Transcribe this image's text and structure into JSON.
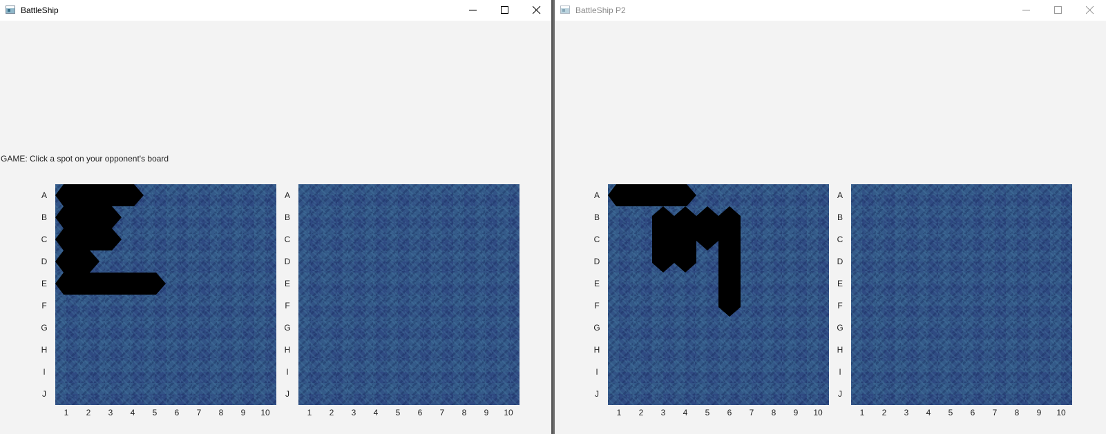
{
  "windows": [
    {
      "id": "win1",
      "title": "BattleShip",
      "active": true,
      "status": "GAME: Click a spot on your opponent's board",
      "boards": [
        {
          "label": "own-board",
          "ships": [
            {
              "row": "A",
              "col": 1,
              "length": 4,
              "orientation": "horizontal"
            },
            {
              "row": "B",
              "col": 1,
              "length": 3,
              "orientation": "horizontal"
            },
            {
              "row": "C",
              "col": 1,
              "length": 3,
              "orientation": "horizontal"
            },
            {
              "row": "D",
              "col": 1,
              "length": 2,
              "orientation": "horizontal"
            },
            {
              "row": "E",
              "col": 1,
              "length": 5,
              "orientation": "horizontal"
            }
          ]
        },
        {
          "label": "target-board",
          "ships": []
        }
      ]
    },
    {
      "id": "win2",
      "title": "BattleShip P2",
      "active": false,
      "status": "",
      "boards": [
        {
          "label": "own-board",
          "ships": [
            {
              "row": "A",
              "col": 1,
              "length": 4,
              "orientation": "horizontal"
            },
            {
              "row": "B",
              "col": 3,
              "length": 3,
              "orientation": "vertical"
            },
            {
              "row": "B",
              "col": 4,
              "length": 3,
              "orientation": "vertical"
            },
            {
              "row": "B",
              "col": 5,
              "length": 2,
              "orientation": "vertical"
            },
            {
              "row": "B",
              "col": 6,
              "length": 5,
              "orientation": "vertical"
            }
          ]
        },
        {
          "label": "target-board",
          "ships": []
        }
      ]
    }
  ],
  "rows": [
    "A",
    "B",
    "C",
    "D",
    "E",
    "F",
    "G",
    "H",
    "I",
    "J"
  ],
  "cols": [
    "1",
    "2",
    "3",
    "4",
    "5",
    "6",
    "7",
    "8",
    "9",
    "10"
  ],
  "colors": {
    "ship": "#000000",
    "water": "#2f4a82"
  },
  "icons": {
    "minimize": "minimize-icon",
    "maximize": "maximize-icon",
    "close": "close-icon",
    "app": "app-icon"
  }
}
